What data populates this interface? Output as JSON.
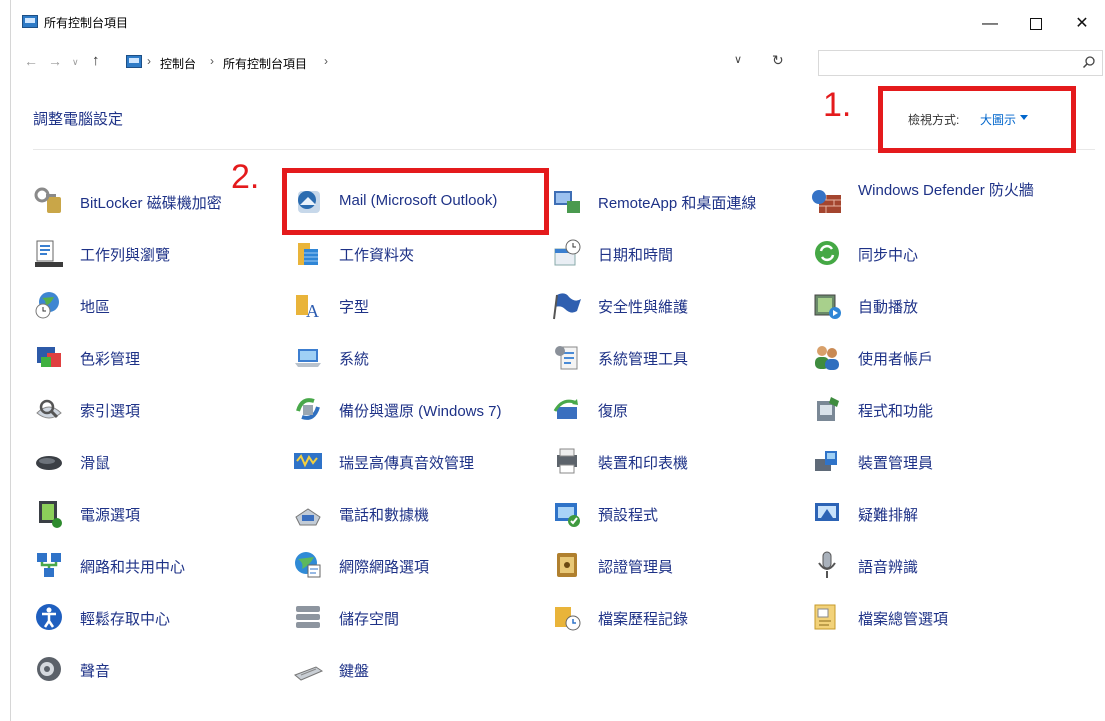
{
  "window": {
    "title": "所有控制台項目",
    "minimize": "—",
    "close": "✕"
  },
  "address": {
    "crumbs": [
      "控制台",
      "所有控制台項目"
    ],
    "back_icon": "arrow-left-icon",
    "forward_icon": "arrow-right-icon",
    "up_icon": "arrow-up-icon",
    "refresh_icon": "refresh-icon"
  },
  "search": {
    "placeholder": "",
    "value": ""
  },
  "header": {
    "title": "調整電腦設定",
    "view_by_label": "檢視方式:",
    "view_by_value": "大圖示"
  },
  "annotations": [
    "1.",
    "2."
  ],
  "colors": {
    "link": "#1e3287",
    "accent": "#0066cc",
    "annotation": "#e41a1c"
  },
  "items": [
    {
      "label": "BitLocker 磁碟機加密",
      "icon": "bitlocker-key-icon"
    },
    {
      "label": "Mail (Microsoft Outlook)",
      "icon": "mail-icon"
    },
    {
      "label": "RemoteApp 和桌面連線",
      "icon": "remoteapp-icon"
    },
    {
      "label": "Windows Defender 防火牆",
      "icon": "firewall-icon"
    },
    {
      "label": "工作列與瀏覽",
      "icon": "taskbar-icon"
    },
    {
      "label": "工作資料夾",
      "icon": "work-folders-icon"
    },
    {
      "label": "日期和時間",
      "icon": "date-time-icon"
    },
    {
      "label": "同步中心",
      "icon": "sync-center-icon"
    },
    {
      "label": "地區",
      "icon": "region-globe-icon"
    },
    {
      "label": "字型",
      "icon": "fonts-icon"
    },
    {
      "label": "安全性與維護",
      "icon": "security-flag-icon"
    },
    {
      "label": "自動播放",
      "icon": "autoplay-icon"
    },
    {
      "label": "色彩管理",
      "icon": "color-management-icon"
    },
    {
      "label": "系統",
      "icon": "system-laptop-icon"
    },
    {
      "label": "系統管理工具",
      "icon": "admin-tools-icon"
    },
    {
      "label": "使用者帳戶",
      "icon": "user-accounts-icon"
    },
    {
      "label": "索引選項",
      "icon": "indexing-icon"
    },
    {
      "label": "備份與還原 (Windows 7)",
      "icon": "backup-restore-icon"
    },
    {
      "label": "復原",
      "icon": "recovery-icon"
    },
    {
      "label": "程式和功能",
      "icon": "programs-icon"
    },
    {
      "label": "滑鼠",
      "icon": "mouse-icon"
    },
    {
      "label": "瑞昱高傳真音效管理",
      "icon": "realtek-audio-icon"
    },
    {
      "label": "裝置和印表機",
      "icon": "devices-printers-icon"
    },
    {
      "label": "裝置管理員",
      "icon": "device-manager-icon"
    },
    {
      "label": "電源選項",
      "icon": "power-options-icon"
    },
    {
      "label": "電話和數據機",
      "icon": "phone-modem-icon"
    },
    {
      "label": "預設程式",
      "icon": "default-programs-icon"
    },
    {
      "label": "疑難排解",
      "icon": "troubleshooting-icon"
    },
    {
      "label": "網路和共用中心",
      "icon": "network-sharing-icon"
    },
    {
      "label": "網際網路選項",
      "icon": "internet-options-icon"
    },
    {
      "label": "認證管理員",
      "icon": "credential-manager-icon"
    },
    {
      "label": "語音辨識",
      "icon": "speech-microphone-icon"
    },
    {
      "label": "輕鬆存取中心",
      "icon": "ease-of-access-icon"
    },
    {
      "label": "儲存空間",
      "icon": "storage-spaces-icon"
    },
    {
      "label": "檔案歷程記錄",
      "icon": "file-history-icon"
    },
    {
      "label": "檔案總管選項",
      "icon": "explorer-options-icon"
    },
    {
      "label": "聲音",
      "icon": "sound-speaker-icon"
    },
    {
      "label": "鍵盤",
      "icon": "keyboard-icon"
    }
  ]
}
